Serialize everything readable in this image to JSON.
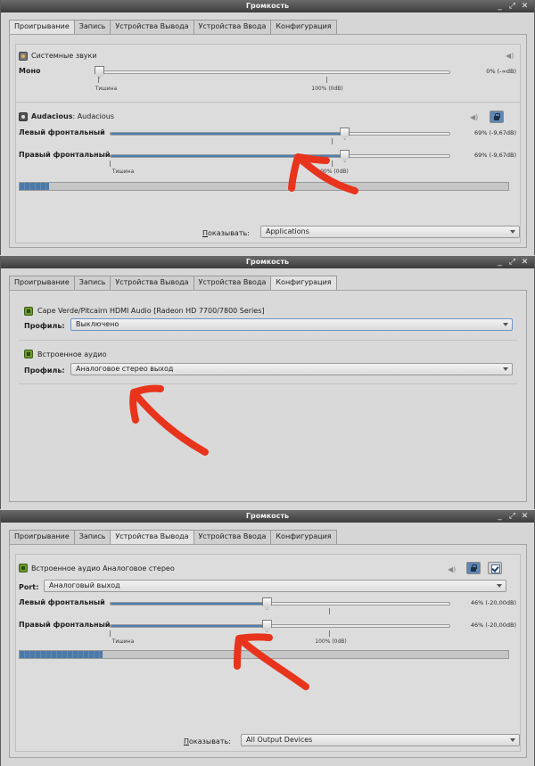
{
  "window_title": "Громкость",
  "window_buttons": [
    "_",
    "⤢",
    "✕"
  ],
  "tabs": [
    "Проигрывание",
    "Запись",
    "Устройства Вывода",
    "Устройства Ввода",
    "Конфигурация"
  ],
  "panel1": {
    "system_sounds": {
      "label": "Системные звуки",
      "channel": "Моно",
      "value_text": "0% (-∞dB)",
      "level": 0,
      "tick_left": "Тишина",
      "tick_mid": "100% (0dB)"
    },
    "app": {
      "name": "Audacious",
      "separator": ": ",
      "stream": "Audacious",
      "left_label": "Левый фронтальный",
      "right_label": "Правый фронтальный",
      "left_value": "69% (-9,67dB)",
      "right_value": "69% (-9,67dB)",
      "level": 0.69,
      "tick_left": "Тишина",
      "tick_mid": "100% (0dB)",
      "meter": 0.06
    },
    "show_label": "Показывать:",
    "show_value": "Applications"
  },
  "panel2": {
    "card1": {
      "name": "Cape Verde/Pitcairn HDMI Audio [Radeon HD 7700/7800 Series]",
      "profile_label": "Профиль:",
      "profile_value": "Выключено"
    },
    "card2": {
      "name": "Встроенное аудио",
      "profile_label": "Профиль:",
      "profile_value": "Аналоговое стерео выход"
    }
  },
  "panel3": {
    "device": {
      "name": "Встроенное аудио Аналоговое стерео",
      "port_label": "Port:",
      "port_value": "Аналоговый выход",
      "left_label": "Левый фронтальный",
      "right_label": "Правый фронтальный",
      "left_value": "46% (-20,00dB)",
      "right_value": "46% (-20,00dB)",
      "level": 0.46,
      "tick_left": "Тишина",
      "tick_mid": "100% (0dB)",
      "meter": 0.17
    },
    "show_label": "Показывать:",
    "show_value": "All Output Devices"
  },
  "annotation_color": "#e8341c"
}
